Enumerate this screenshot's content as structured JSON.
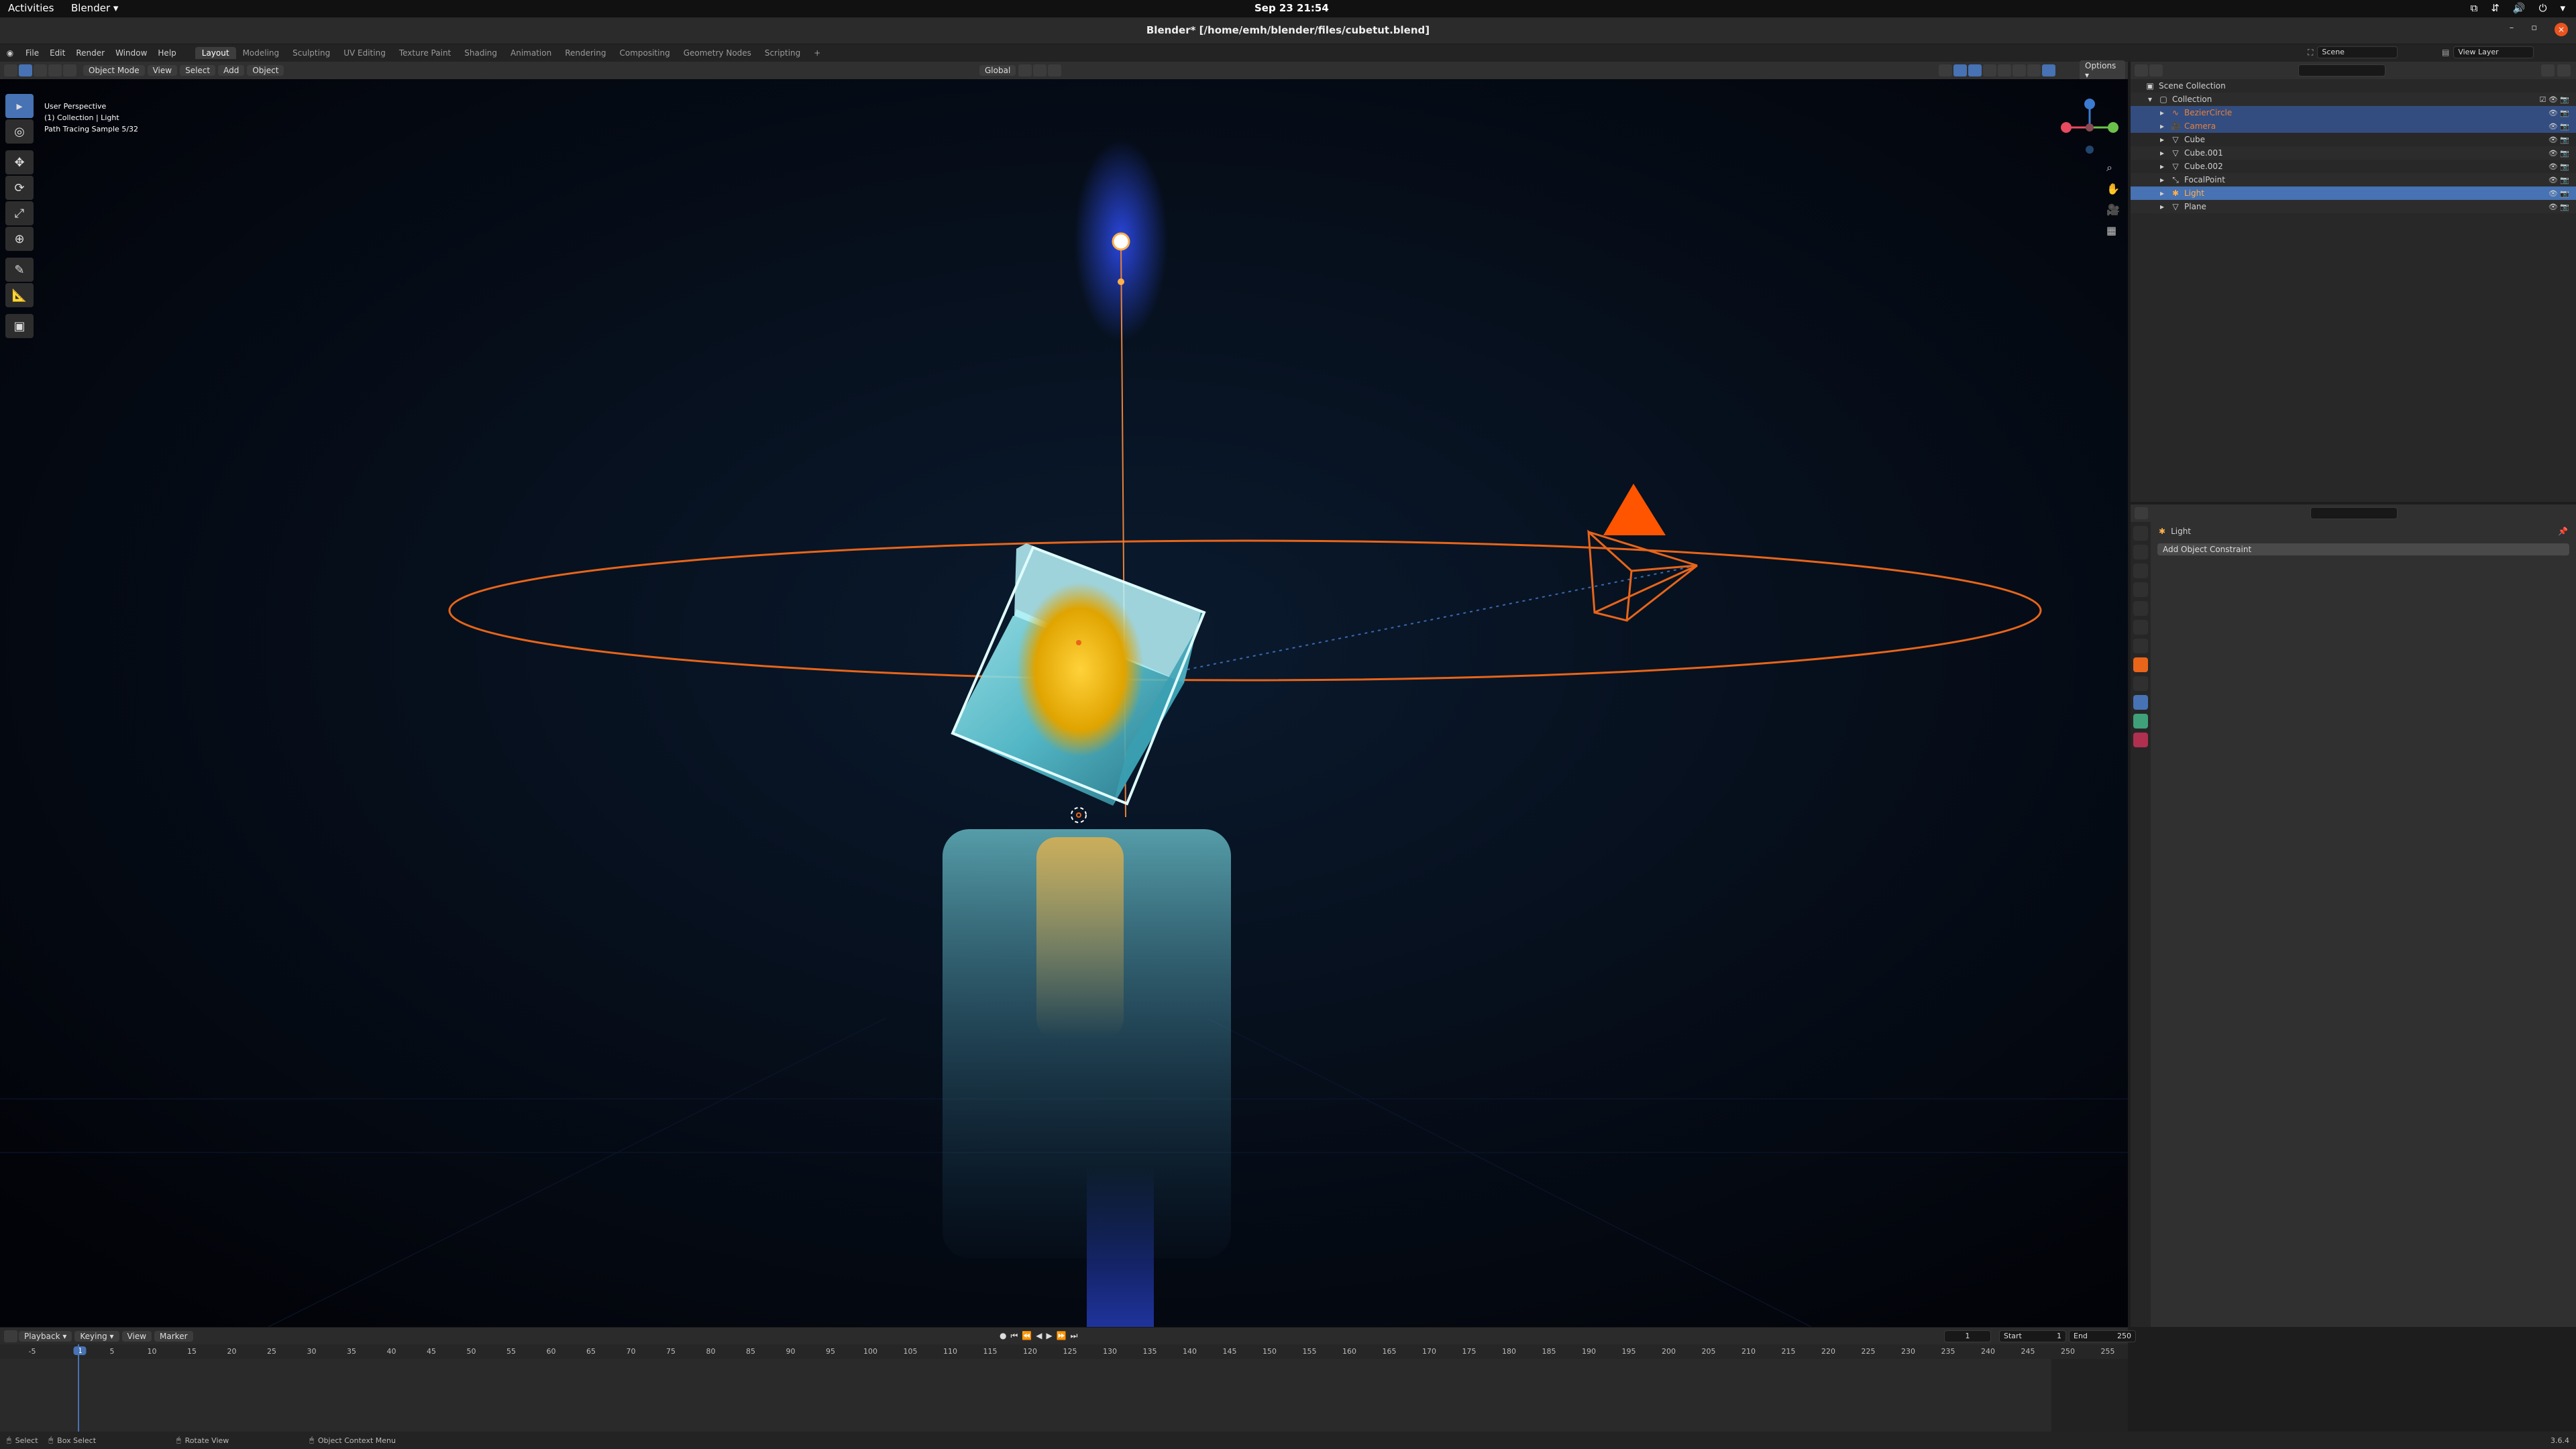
{
  "gnome": {
    "activities": "Activities",
    "app_menu": "Blender ▾",
    "clock": "Sep 23  21:54",
    "tray": [
      "⧉",
      "⇵",
      "🔊",
      "⏻",
      "▾"
    ]
  },
  "window": {
    "title": "Blender* [/home/emh/blender/files/cubetut.blend]",
    "controls": [
      "–",
      "▫",
      "×"
    ]
  },
  "menu": [
    "File",
    "Edit",
    "Render",
    "Window",
    "Help"
  ],
  "workspace_tabs": [
    "Layout",
    "Modeling",
    "Sculpting",
    "UV Editing",
    "Texture Paint",
    "Shading",
    "Animation",
    "Rendering",
    "Compositing",
    "Geometry Nodes",
    "Scripting",
    "+"
  ],
  "scene": {
    "label": "Scene",
    "view_layer": "View Layer"
  },
  "viewport_header": {
    "mode": "Object Mode",
    "menus": [
      "View",
      "Select",
      "Add",
      "Object"
    ],
    "orientation": "Global",
    "options": "Options ▾"
  },
  "viewport": {
    "overlay_lines": [
      "User Perspective",
      "(1) Collection | Light",
      "Path Tracing Sample 5/32"
    ],
    "gizmo_labels": {
      "x": "X",
      "y": "Y",
      "z": "Z"
    }
  },
  "toolbar": [
    "▸",
    "◎",
    "✥",
    "⟳",
    "⤢",
    "⊕",
    "✎",
    "📐",
    "▣"
  ],
  "timeline": {
    "menus": [
      "Playback ▾",
      "Keying ▾",
      "View",
      "Marker"
    ],
    "current_frame": "1",
    "start_label": "Start",
    "start": "1",
    "end_label": "End",
    "end": "250",
    "ticks": [
      "-5",
      "1",
      "5",
      "10",
      "15",
      "20",
      "25",
      "30",
      "35",
      "40",
      "45",
      "50",
      "55",
      "60",
      "65",
      "70",
      "75",
      "80",
      "85",
      "90",
      "95",
      "100",
      "105",
      "110",
      "115",
      "120",
      "125",
      "130",
      "135",
      "140",
      "145",
      "150",
      "155",
      "160",
      "165",
      "170",
      "175",
      "180",
      "185",
      "190",
      "195",
      "200",
      "205",
      "210",
      "215",
      "220",
      "225",
      "230",
      "235",
      "240",
      "245",
      "250",
      "255"
    ]
  },
  "outliner": {
    "root": "Scene Collection",
    "collection": "Collection",
    "items": [
      {
        "name": "BezierCircle",
        "icon": "curve-icon",
        "color": "#e8813a"
      },
      {
        "name": "Camera",
        "icon": "camera-icon",
        "color": "#e8813a"
      },
      {
        "name": "Cube",
        "icon": "mesh-icon",
        "color": "#d0d0d0"
      },
      {
        "name": "Cube.001",
        "icon": "mesh-icon",
        "color": "#d0d0d0"
      },
      {
        "name": "Cube.002",
        "icon": "mesh-icon",
        "color": "#d0d0d0"
      },
      {
        "name": "FocalPoint",
        "icon": "empty-icon",
        "color": "#d0d0d0"
      },
      {
        "name": "Light",
        "icon": "light-icon",
        "color": "#ffb04a"
      },
      {
        "name": "Plane",
        "icon": "mesh-icon",
        "color": "#d0d0d0"
      }
    ]
  },
  "properties": {
    "object_name": "Light",
    "add_constraint": "Add Object Constraint"
  },
  "status_bar": {
    "items": [
      "Select",
      "Box Select",
      "Rotate View",
      "Object Context Menu"
    ],
    "version": "3.6.4"
  },
  "colors": {
    "accent": "#4772b3",
    "selection_orange": "#e8651a",
    "cube_cyan": "#7fe6ef",
    "light_glow": "#ffd23a"
  }
}
